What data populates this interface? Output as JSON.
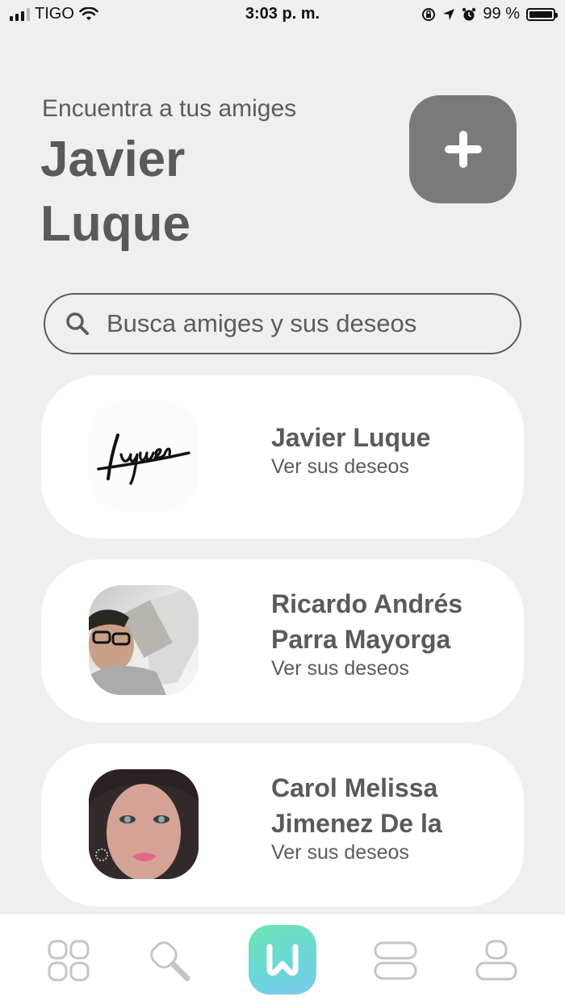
{
  "status_bar": {
    "carrier": "TIGO",
    "time": "3:03 p. m.",
    "battery": "99 %",
    "battery_level": 0.99
  },
  "header": {
    "subtitle": "Encuentra a tus amiges",
    "user_name": "Javier Luque"
  },
  "search": {
    "placeholder": "Busca amiges y sus deseos"
  },
  "friends": [
    {
      "name": "Javier Luque",
      "link": "Ver sus deseos",
      "avatar": "luque-signature-logo"
    },
    {
      "name": "Ricardo Andrés Parra Mayorga",
      "link": "Ver sus deseos",
      "avatar": "photo-man-glasses"
    },
    {
      "name": "Carol Melissa Jimenez De la",
      "link": "Ver sus deseos",
      "avatar": "photo-woman"
    }
  ],
  "nav": {
    "items": [
      "grid-icon",
      "search-icon",
      "app-logo-icon",
      "list-icon",
      "profile-icon"
    ],
    "accent": "#6fe3b4"
  }
}
